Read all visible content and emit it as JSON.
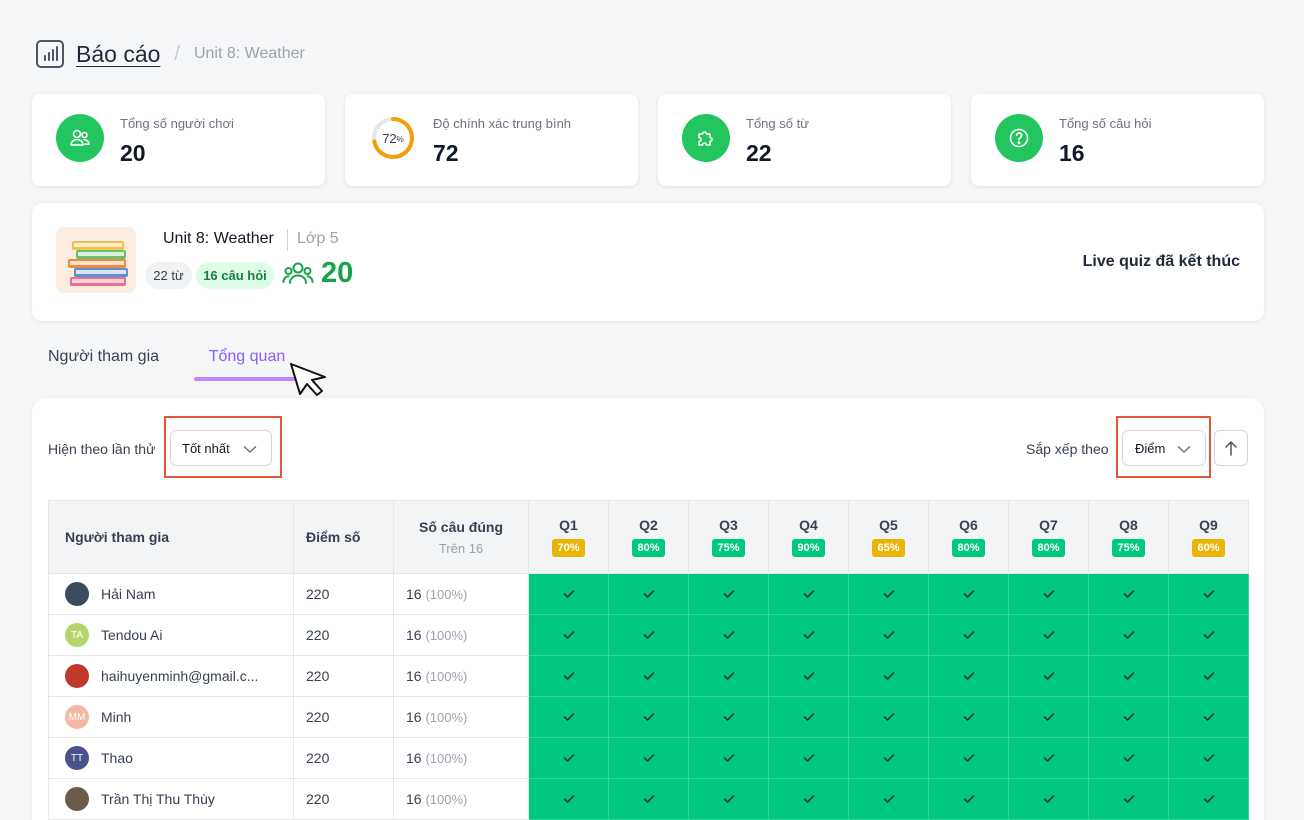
{
  "header": {
    "title": "Báo cáo",
    "breadcrumb": "Unit 8: Weather"
  },
  "stats": [
    {
      "label": "Tổng số người chơi",
      "value": "20",
      "icon": "users-icon"
    },
    {
      "label": "Độ chính xác trung bình",
      "value": "72",
      "ring_value": "72",
      "ring_unit": "%",
      "ring_fraction": 0.72
    },
    {
      "label": "Tổng số từ",
      "value": "22",
      "icon": "puzzle-icon"
    },
    {
      "label": "Tổng số câu hỏi",
      "value": "16",
      "icon": "question-icon"
    }
  ],
  "unit": {
    "name": "Unit 8: Weather",
    "class": "Lớp 5",
    "words_chip": "22 từ",
    "questions_chip": "16 câu hỏi",
    "players": "20",
    "status": "Live quiz đã kết thúc"
  },
  "tabs": [
    {
      "label": "Người tham gia"
    },
    {
      "label": "Tổng quan",
      "active": true
    }
  ],
  "filters": {
    "attempt_label": "Hiện theo lần thử",
    "attempt_value": "Tốt nhất",
    "sort_label": "Sắp xếp theo",
    "sort_value": "Điểm"
  },
  "colors": {
    "accent": "#8b5cf6",
    "green": "#22c55e",
    "correct": "#00c87e",
    "warn": "#eab308"
  },
  "table": {
    "headers": {
      "participant": "Người tham gia",
      "score": "Điểm số",
      "correct": "Số câu đúng",
      "correct_sub": "Trên 16"
    },
    "questions": [
      {
        "label": "Q1",
        "pct": "70%",
        "level": "warn"
      },
      {
        "label": "Q2",
        "pct": "80%",
        "level": "good"
      },
      {
        "label": "Q3",
        "pct": "75%",
        "level": "good"
      },
      {
        "label": "Q4",
        "pct": "90%",
        "level": "good"
      },
      {
        "label": "Q5",
        "pct": "65%",
        "level": "warn"
      },
      {
        "label": "Q6",
        "pct": "80%",
        "level": "good"
      },
      {
        "label": "Q7",
        "pct": "80%",
        "level": "good"
      },
      {
        "label": "Q8",
        "pct": "75%",
        "level": "good"
      },
      {
        "label": "Q9",
        "pct": "60%",
        "level": "warn"
      }
    ],
    "rows": [
      {
        "name": "Hải Nam",
        "initials": "",
        "avatar_color": "#3b4a5e",
        "score": "220",
        "correct": "16",
        "correct_pct": "(100%)"
      },
      {
        "name": "Tendou Ai",
        "initials": "TA",
        "avatar_color": "#b5d66b",
        "score": "220",
        "correct": "16",
        "correct_pct": "(100%)"
      },
      {
        "name": "haihuyenminh@gmail.c...",
        "initials": "",
        "avatar_color": "#c0392b",
        "score": "220",
        "correct": "16",
        "correct_pct": "(100%)"
      },
      {
        "name": "Minh",
        "initials": "MM",
        "avatar_color": "#f5b8a6",
        "score": "220",
        "correct": "16",
        "correct_pct": "(100%)"
      },
      {
        "name": "Thao",
        "initials": "TT",
        "avatar_color": "#4a5389",
        "score": "220",
        "correct": "16",
        "correct_pct": "(100%)"
      },
      {
        "name": "Trần Thị Thu Thùy",
        "initials": "",
        "avatar_color": "#6b5b4b",
        "score": "220",
        "correct": "16",
        "correct_pct": "(100%)"
      }
    ]
  }
}
